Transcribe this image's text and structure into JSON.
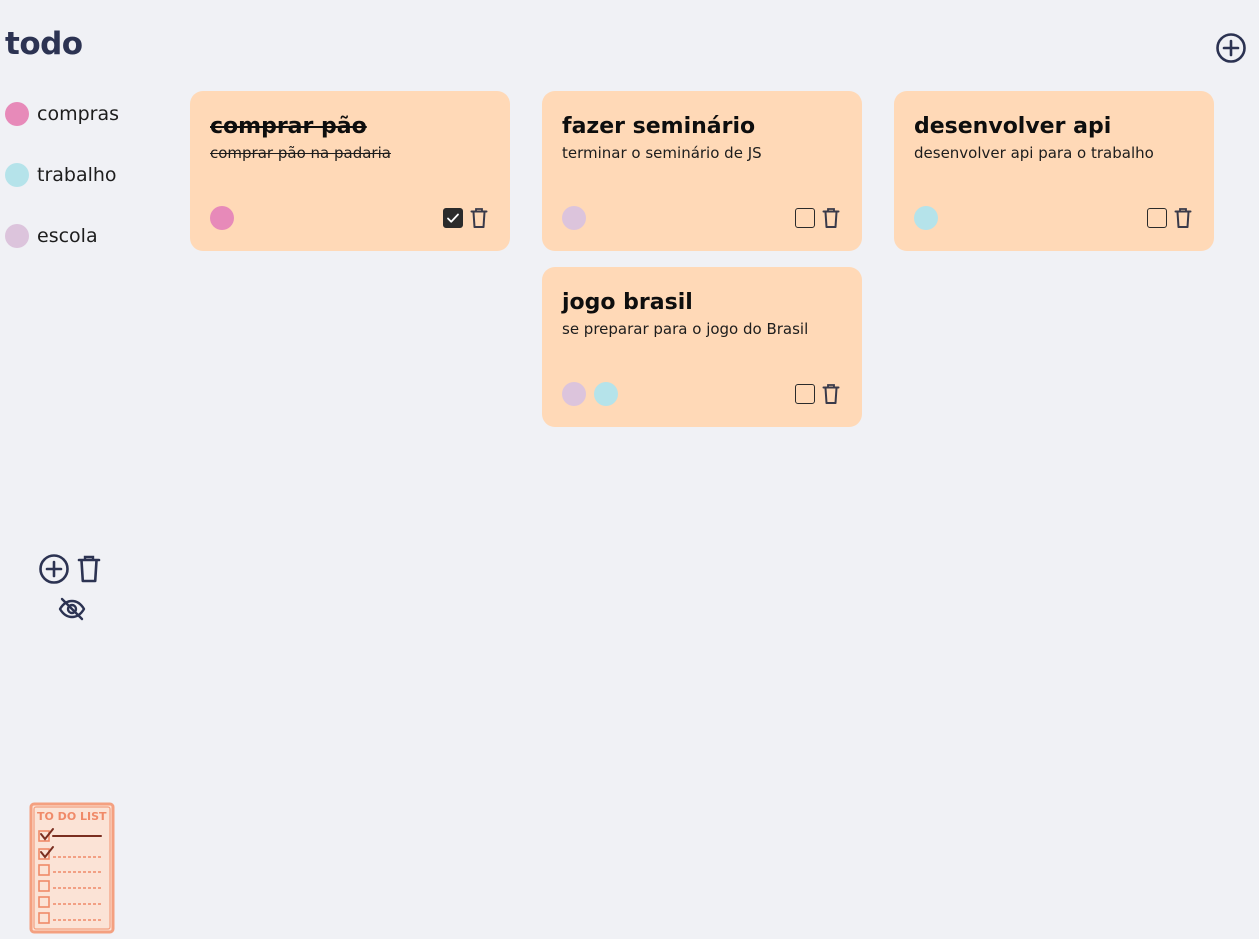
{
  "header": {
    "title": "todo"
  },
  "tags": [
    {
      "label": "compras",
      "color": "#e78ab9"
    },
    {
      "label": "trabalho",
      "color": "#b5e3ea"
    },
    {
      "label": "escola",
      "color": "#dcc4dc"
    }
  ],
  "notes": [
    {
      "title": "comprar pão",
      "description": "comprar pão na padaria",
      "done": true,
      "tag_colors": [
        "#e78ab9"
      ]
    },
    {
      "title": "fazer seminário",
      "description": "terminar o seminário de JS",
      "done": false,
      "tag_colors": [
        "#dcc4dc"
      ]
    },
    {
      "title": "desenvolver api",
      "description": "desenvolver api para o trabalho",
      "done": false,
      "tag_colors": [
        "#b5e3ea"
      ]
    },
    {
      "title": "jogo brasil",
      "description": "se preparar para o jogo do Brasil",
      "done": false,
      "tag_colors": [
        "#dcc4dc",
        "#b5e3ea"
      ]
    }
  ],
  "logo": {
    "text": "TO DO LIST"
  },
  "colors": {
    "background": "#f0f1f5",
    "card": "#ffd9b7",
    "accent": "#2c3352",
    "logo": "#f4a080"
  },
  "icons": {
    "add": "plus-circle-icon",
    "delete": "trash-icon",
    "hide": "eye-off-icon",
    "checkbox": "checkbox-icon"
  }
}
